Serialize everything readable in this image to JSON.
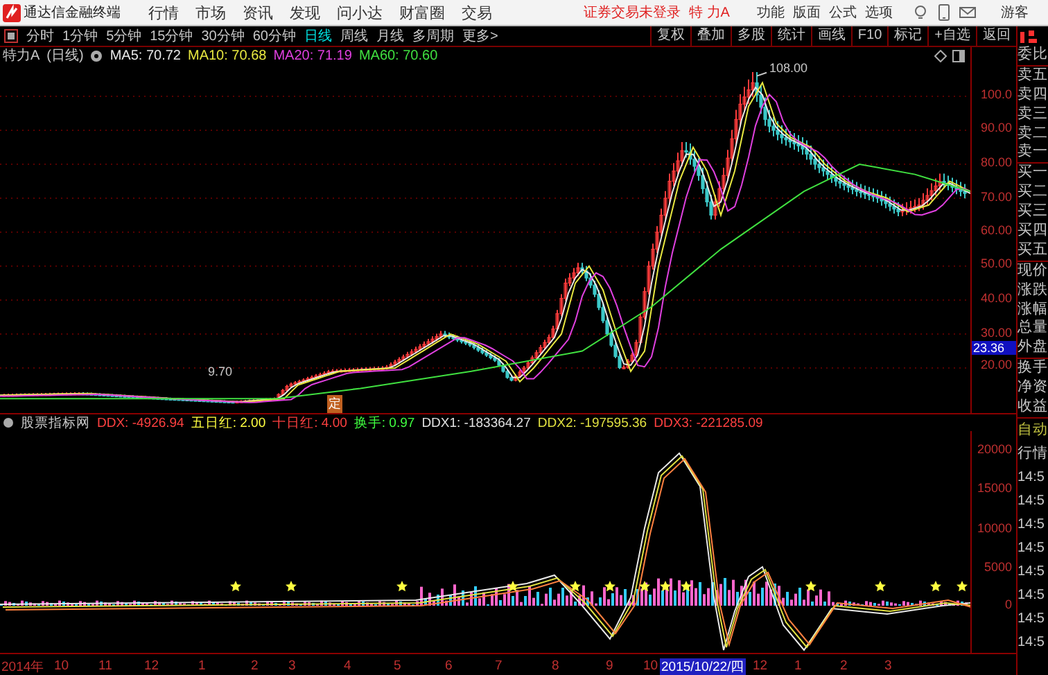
{
  "app": {
    "name": "通达信金融终端"
  },
  "menu": [
    "行情",
    "市场",
    "资讯",
    "发现",
    "问小达",
    "财富圈",
    "交易"
  ],
  "login_notice": "证券交易未登录",
  "top_stock": "特 力A",
  "right_menu": [
    "功能",
    "版面",
    "公式",
    "选项"
  ],
  "user": "游客",
  "periods": [
    {
      "label": "分时",
      "selected": false
    },
    {
      "label": "1分钟",
      "selected": false
    },
    {
      "label": "5分钟",
      "selected": false
    },
    {
      "label": "15分钟",
      "selected": false
    },
    {
      "label": "30分钟",
      "selected": false
    },
    {
      "label": "60分钟",
      "selected": false
    },
    {
      "label": "日线",
      "selected": true
    },
    {
      "label": "周线",
      "selected": false
    },
    {
      "label": "月线",
      "selected": false
    },
    {
      "label": "多周期",
      "selected": false
    },
    {
      "label": "更多>",
      "selected": false
    }
  ],
  "tools": [
    "复权",
    "叠加",
    "多股",
    "统计",
    "画线",
    "F10",
    "标记",
    "+自选",
    "返回"
  ],
  "chart": {
    "stock": "特力A",
    "period": "(日线)",
    "ma": [
      {
        "label": "MA5: 70.72",
        "color": "#e8e8e8"
      },
      {
        "label": "MA10: 70.68",
        "color": "#e8e840"
      },
      {
        "label": "MA20: 71.19",
        "color": "#e040e0"
      },
      {
        "label": "MA60: 70.60",
        "color": "#40e040"
      }
    ],
    "high_label": "108.00",
    "low_label": "9.70",
    "marker": "定",
    "yticks": [
      "100.0",
      "90.00",
      "80.00",
      "70.00",
      "60.00",
      "50.00",
      "40.00",
      "30.00",
      "20.00"
    ],
    "current_price": "23.36"
  },
  "indicator": {
    "name": "股票指标网",
    "values": [
      {
        "label": "DDX: -4926.94",
        "color": "#ff4040"
      },
      {
        "label": "五日红: 2.00",
        "color": "#ffff40"
      },
      {
        "label": "十日红: 4.00",
        "color": "#ff4040"
      },
      {
        "label": "换手: 0.97",
        "color": "#40ff40"
      },
      {
        "label": "DDX1: -183364.27",
        "color": "#e0e0e0"
      },
      {
        "label": "DDX2: -197595.36",
        "color": "#e0e040"
      },
      {
        "label": "DDX3: -221285.09",
        "color": "#ff4040"
      }
    ],
    "yticks": [
      "20000",
      "15000",
      "10000",
      "5000",
      "0"
    ]
  },
  "time_axis": [
    {
      "label": "2014年",
      "selected": false
    },
    {
      "label": "10",
      "selected": false
    },
    {
      "label": "11",
      "selected": false
    },
    {
      "label": "12",
      "selected": false
    },
    {
      "label": "1",
      "selected": false
    },
    {
      "label": "2",
      "selected": false
    },
    {
      "label": "3",
      "selected": false
    },
    {
      "label": "4",
      "selected": false
    },
    {
      "label": "5",
      "selected": false
    },
    {
      "label": "6",
      "selected": false
    },
    {
      "label": "7",
      "selected": false
    },
    {
      "label": "8",
      "selected": false
    },
    {
      "label": "9",
      "selected": false
    },
    {
      "label": "10",
      "selected": false
    },
    {
      "label": "2015/10/22/四",
      "selected": true
    },
    {
      "label": "12",
      "selected": false
    },
    {
      "label": "1",
      "selected": false
    },
    {
      "label": "2",
      "selected": false
    },
    {
      "label": "3",
      "selected": false
    }
  ],
  "side_panel": {
    "quote_labels": [
      "委比",
      "卖五",
      "卖四",
      "卖三",
      "卖二",
      "卖一",
      "买一",
      "买二",
      "买三",
      "买四",
      "买五",
      "现价",
      "涨跌",
      "涨幅",
      "总量",
      "外盘",
      "换手",
      "净资",
      "收益"
    ],
    "mode": "自动",
    "title": "行情",
    "times": [
      "14:5",
      "14:5",
      "14:5",
      "14:5",
      "14:5",
      "14:5",
      "14:5",
      "14:5"
    ]
  }
}
